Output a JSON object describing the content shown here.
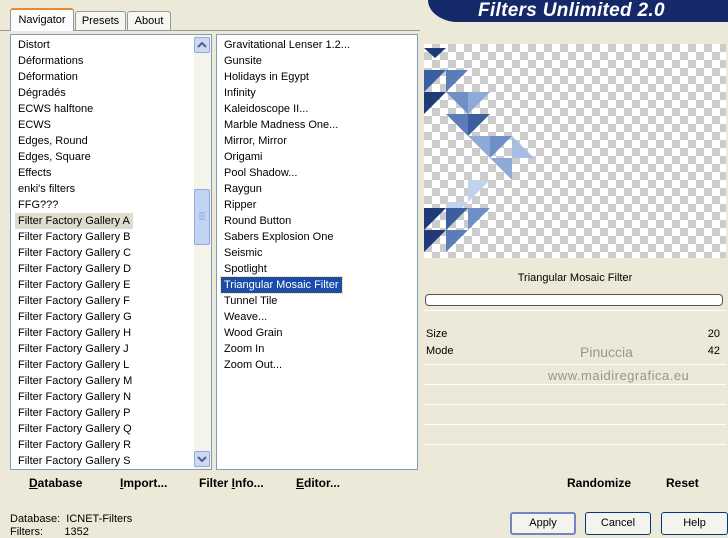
{
  "tabs": [
    {
      "label": "Navigator",
      "active": true
    },
    {
      "label": "Presets",
      "active": false
    },
    {
      "label": "About",
      "active": false
    }
  ],
  "banner": {
    "title": "Filters Unlimited 2.0"
  },
  "categories": {
    "items": [
      "Distort",
      "Déformations",
      "Déformation",
      "Dégradés",
      "ECWS halftone",
      "ECWS",
      "Edges, Round",
      "Edges, Square",
      "Effects",
      "enki's filters",
      "FFG???",
      "Filter Factory Gallery A",
      "Filter Factory Gallery B",
      "Filter Factory Gallery C",
      "Filter Factory Gallery D",
      "Filter Factory Gallery E",
      "Filter Factory Gallery F",
      "Filter Factory Gallery G",
      "Filter Factory Gallery H",
      "Filter Factory Gallery J",
      "Filter Factory Gallery L",
      "Filter Factory Gallery M",
      "Filter Factory Gallery N",
      "Filter Factory Gallery P",
      "Filter Factory Gallery Q",
      "Filter Factory Gallery R",
      "Filter Factory Gallery S"
    ],
    "selected": "Filter Factory Gallery A"
  },
  "filters": {
    "items": [
      "Gravitational Lenser 1.2...",
      "Gunsite",
      "Holidays in Egypt",
      "Infinity",
      "Kaleidoscope II...",
      "Marble Madness One...",
      "Mirror, Mirror",
      "Origami",
      "Pool Shadow...",
      "Raygun",
      "Ripper",
      "Round Button",
      "Sabers Explosion One",
      "Seismic",
      "Spotlight",
      "Triangular Mosaic Filter",
      "Tunnel Tile",
      "Weave...",
      "Wood Grain",
      "Zoom In",
      "Zoom Out..."
    ],
    "selected": "Triangular Mosaic Filter"
  },
  "bottom_links": {
    "database": {
      "u": "D",
      "rest": "atabase"
    },
    "import": {
      "u": "I",
      "rest": "mport..."
    },
    "filter_info": {
      "pre": "Filter ",
      "u": "I",
      "rest": "nfo..."
    },
    "editor": {
      "u": "E",
      "rest": "ditor..."
    },
    "randomize": "Randomize",
    "reset": "Reset"
  },
  "preview": {
    "filter_name": "Triangular Mosaic Filter",
    "progress": 0
  },
  "params": [
    {
      "label": "Size",
      "value": "20"
    },
    {
      "label": "Mode",
      "value": "42"
    }
  ],
  "watermark": {
    "line1": "Pinuccia",
    "line2": "www.maidiregrafica.eu"
  },
  "buttons": {
    "apply": "Apply",
    "cancel": "Cancel",
    "help": "Help"
  },
  "status": {
    "database_label": "Database:",
    "database_value": "ICNET-Filters",
    "filters_label": "Filters:",
    "filters_value": "1352"
  },
  "colors": {
    "banner": "#14286a",
    "selection": "#1a4caa",
    "mosaic_dark": "#1e3a78",
    "mosaic_light": "#8fa9d6"
  }
}
